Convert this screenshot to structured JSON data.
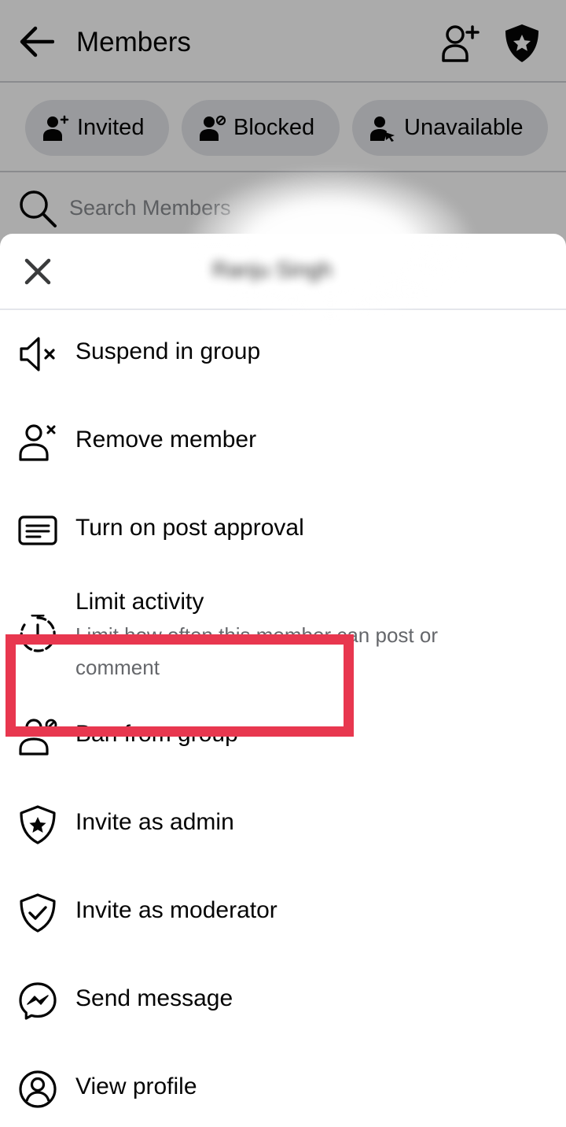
{
  "header": {
    "title": "Members"
  },
  "filters": [
    {
      "label": "Invited"
    },
    {
      "label": "Blocked"
    },
    {
      "label": "Unavailable"
    }
  ],
  "search": {
    "placeholder": "Search Members"
  },
  "sheet": {
    "member_name": "Ranju Singh",
    "menu": [
      {
        "label": "Suspend in group",
        "icon": "mute-icon"
      },
      {
        "label": "Remove member",
        "icon": "remove-person-icon"
      },
      {
        "label": "Turn on post approval",
        "icon": "post-approval-icon"
      },
      {
        "label": "Limit activity",
        "sub": "Limit how often this member can post or comment",
        "icon": "timer-icon"
      },
      {
        "label": "Ban from group",
        "icon": "ban-person-icon"
      },
      {
        "label": "Invite as admin",
        "icon": "shield-star-icon"
      },
      {
        "label": "Invite as moderator",
        "icon": "shield-check-icon"
      },
      {
        "label": "Send message",
        "icon": "messenger-icon"
      },
      {
        "label": "View profile",
        "icon": "profile-icon"
      }
    ]
  },
  "colors": {
    "highlight": "#e8374f",
    "overlay": "rgba(0,0,0,0.33)"
  }
}
